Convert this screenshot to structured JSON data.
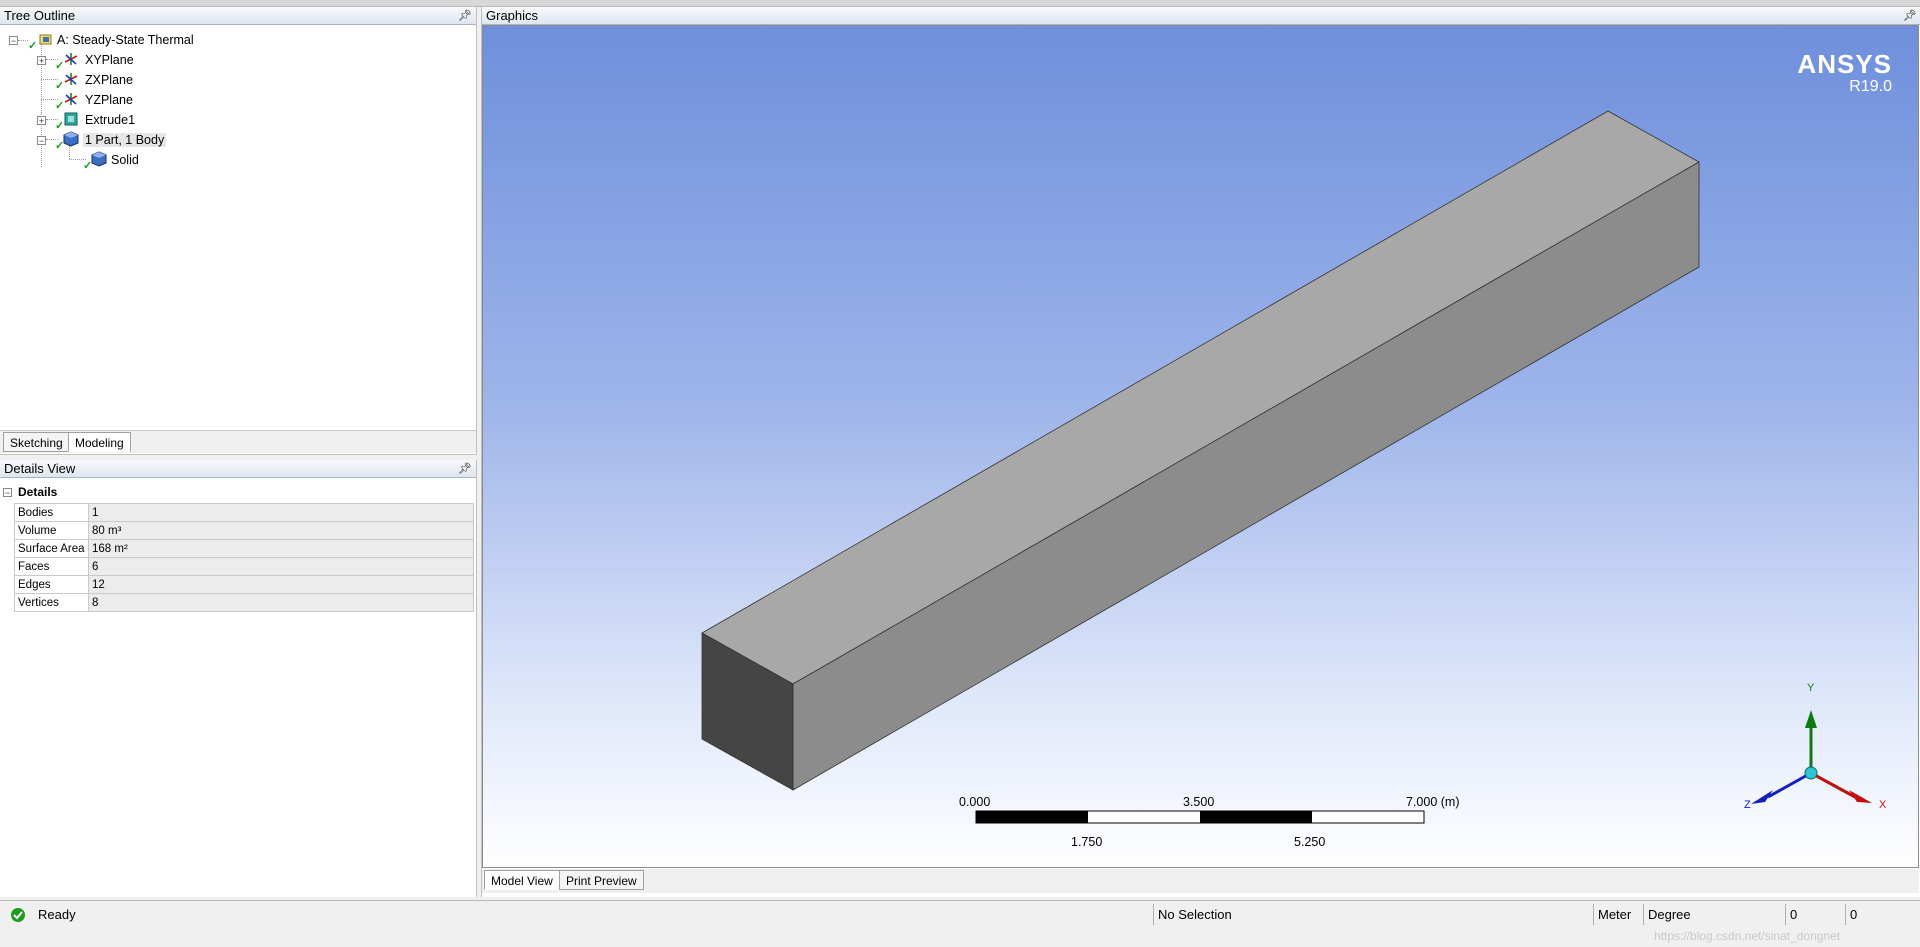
{
  "tree_outline": {
    "title": "Tree Outline",
    "root": "A: Steady-State Thermal",
    "items": [
      "XYPlane",
      "ZXPlane",
      "YZPlane",
      "Extrude1",
      "1 Part, 1 Body",
      "Solid"
    ]
  },
  "tabs": {
    "sketching": "Sketching",
    "modeling": "Modeling"
  },
  "details_view": {
    "title": "Details View",
    "group": "Details",
    "rows": [
      {
        "key": "Bodies",
        "value": "1"
      },
      {
        "key": "Volume",
        "value": "80 m³"
      },
      {
        "key": "Surface Area",
        "value": "168 m²"
      },
      {
        "key": "Faces",
        "value": "6"
      },
      {
        "key": "Edges",
        "value": "12"
      },
      {
        "key": "Vertices",
        "value": "8"
      }
    ]
  },
  "graphics": {
    "title": "Graphics",
    "logo_brand": "ANSYS",
    "logo_version": "R19.0",
    "scale_top": [
      "0.000",
      "3.500",
      "7.000 (m)"
    ],
    "scale_bottom": [
      "1.750",
      "5.250"
    ],
    "axis_labels": {
      "x": "X",
      "y": "Y",
      "z": "Z"
    },
    "tabs": {
      "model_view": "Model View",
      "print_preview": "Print Preview"
    }
  },
  "status": {
    "ready": "Ready",
    "selection": "No Selection",
    "unit_length": "Meter",
    "unit_angle": "Degree",
    "value_1": "0",
    "value_2": "0",
    "watermark": "https://blog.csdn.net/sinat_dongnet"
  },
  "colors": {
    "accent_check": "#1e9a1e",
    "bg_top": "#6f8fdc",
    "box_top": "#a8a8a8",
    "box_front": "#8c8c8c",
    "box_end": "#454545"
  }
}
